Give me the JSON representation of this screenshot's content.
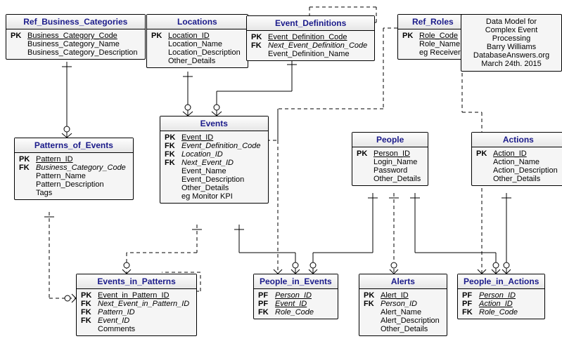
{
  "info": {
    "line1": "Data Model for",
    "line2": "Complex Event Processing",
    "line3": "Barry Williams",
    "line4": "DatabaseAnswers.org",
    "line5": "March 24th. 2015"
  },
  "entities": {
    "ref_business_categories": {
      "title": "Ref_Business_Categories",
      "attrs": [
        {
          "key": "PK",
          "name": "Business_Category_Code",
          "cls": "pk"
        },
        {
          "key": "",
          "name": "Business_Category_Name",
          "cls": ""
        },
        {
          "key": "",
          "name": "Business_Category_Description",
          "cls": ""
        }
      ]
    },
    "locations": {
      "title": "Locations",
      "attrs": [
        {
          "key": "PK",
          "name": "Location_ID",
          "cls": "pk"
        },
        {
          "key": "",
          "name": "Location_Name",
          "cls": ""
        },
        {
          "key": "",
          "name": "Location_Description",
          "cls": ""
        },
        {
          "key": "",
          "name": "Other_Details",
          "cls": ""
        }
      ]
    },
    "event_definitions": {
      "title": "Event_Definitions",
      "attrs": [
        {
          "key": "PK",
          "name": "Event_Definition_Code",
          "cls": "pk"
        },
        {
          "key": "FK",
          "name": "Next_Event_Definition_Code",
          "cls": "fk"
        },
        {
          "key": "",
          "name": "Event_Definition_Name",
          "cls": ""
        }
      ]
    },
    "ref_roles": {
      "title": "Ref_Roles",
      "attrs": [
        {
          "key": "PK",
          "name": "Role_Code",
          "cls": "pk"
        },
        {
          "key": "",
          "name": "Role_Name",
          "cls": ""
        },
        {
          "key": "",
          "name": "eg Receiver",
          "cls": ""
        }
      ]
    },
    "patterns_of_events": {
      "title": "Patterns_of_Events",
      "attrs": [
        {
          "key": "PK",
          "name": "Pattern_ID",
          "cls": "pk"
        },
        {
          "key": "FK",
          "name": "Business_Category_Code",
          "cls": "fk"
        },
        {
          "key": "",
          "name": "Pattern_Name",
          "cls": ""
        },
        {
          "key": "",
          "name": "Pattern_Description",
          "cls": ""
        },
        {
          "key": "",
          "name": "Tags",
          "cls": ""
        }
      ]
    },
    "events": {
      "title": "Events",
      "attrs": [
        {
          "key": "PK",
          "name": "Event_ID",
          "cls": "pk"
        },
        {
          "key": "FK",
          "name": "Event_Definition_Code",
          "cls": "fk"
        },
        {
          "key": "FK",
          "name": "Location_ID",
          "cls": "fk"
        },
        {
          "key": "FK",
          "name": "Next_Event_ID",
          "cls": "fk"
        },
        {
          "key": "",
          "name": "Event_Name",
          "cls": ""
        },
        {
          "key": "",
          "name": "Event_Description",
          "cls": ""
        },
        {
          "key": "",
          "name": "Other_Details",
          "cls": ""
        },
        {
          "key": "",
          "name": "eg Monitor KPI",
          "cls": ""
        }
      ]
    },
    "people": {
      "title": "People",
      "attrs": [
        {
          "key": "PK",
          "name": "Person_ID",
          "cls": "pk"
        },
        {
          "key": "",
          "name": "Login_Name",
          "cls": ""
        },
        {
          "key": "",
          "name": "Password",
          "cls": ""
        },
        {
          "key": "",
          "name": "Other_Details",
          "cls": ""
        }
      ]
    },
    "actions": {
      "title": "Actions",
      "attrs": [
        {
          "key": "PK",
          "name": "Action_ID",
          "cls": "pk"
        },
        {
          "key": "",
          "name": "Action_Name",
          "cls": ""
        },
        {
          "key": "",
          "name": "Action_Description",
          "cls": ""
        },
        {
          "key": "",
          "name": "Other_Details",
          "cls": ""
        }
      ]
    },
    "events_in_patterns": {
      "title": "Events_in_Patterns",
      "attrs": [
        {
          "key": "PK",
          "name": "Event_in_Pattern_ID",
          "cls": "pk"
        },
        {
          "key": "FK",
          "name": "Next_Event_in_Pattern_ID",
          "cls": "fk"
        },
        {
          "key": "FK",
          "name": "Pattern_ID",
          "cls": "fk"
        },
        {
          "key": "FK",
          "name": "Event_ID",
          "cls": "fk"
        },
        {
          "key": "",
          "name": "Comments",
          "cls": ""
        }
      ]
    },
    "people_in_events": {
      "title": "People_in_Events",
      "attrs": [
        {
          "key": "PF",
          "name": "Person_ID",
          "cls": "pf"
        },
        {
          "key": "PF",
          "name": "Event_ID",
          "cls": "pf"
        },
        {
          "key": "FK",
          "name": "Role_Code",
          "cls": "fk"
        }
      ]
    },
    "alerts": {
      "title": "Alerts",
      "attrs": [
        {
          "key": "PK",
          "name": "Alert_ID",
          "cls": "pk"
        },
        {
          "key": "FK",
          "name": "Person_ID",
          "cls": "fk"
        },
        {
          "key": "",
          "name": "Alert_Name",
          "cls": ""
        },
        {
          "key": "",
          "name": "Alert_Description",
          "cls": ""
        },
        {
          "key": "",
          "name": "Other_Details",
          "cls": ""
        }
      ]
    },
    "people_in_actions": {
      "title": "People_in_Actions",
      "attrs": [
        {
          "key": "PF",
          "name": "Person_ID",
          "cls": "pf"
        },
        {
          "key": "PF",
          "name": "Action_ID",
          "cls": "pf"
        },
        {
          "key": "FK",
          "name": "Role_Code",
          "cls": "fk"
        }
      ]
    }
  }
}
